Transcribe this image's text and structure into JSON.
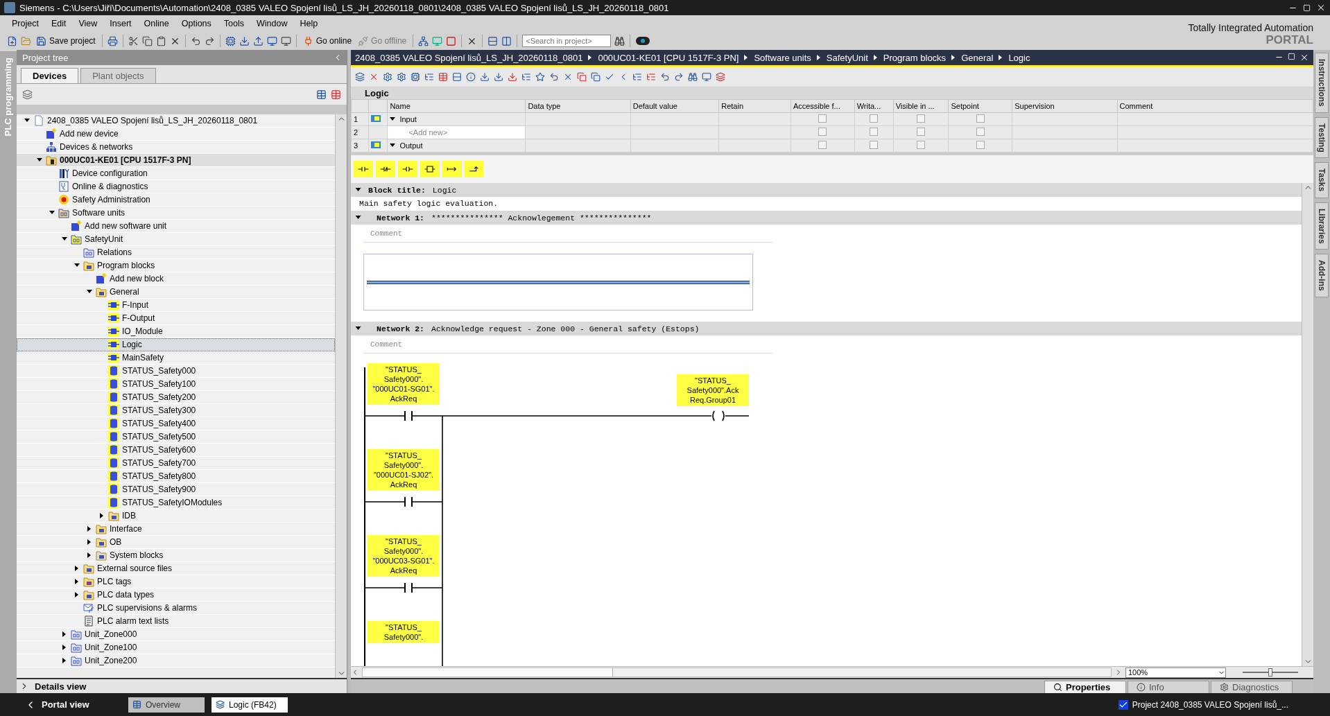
{
  "title_bar": {
    "text": "Siemens  -  C:\\Users\\Jiří\\Documents\\Automation\\2408_0385 VALEO Spojení lisů_LS_JH_20260118_0801\\2408_0385 VALEO Spojení lisů_LS_JH_20260118_0801"
  },
  "menu": [
    "Project",
    "Edit",
    "View",
    "Insert",
    "Online",
    "Options",
    "Tools",
    "Window",
    "Help"
  ],
  "toolbar": {
    "save": "Save project",
    "go_online": "Go online",
    "go_offline": "Go offline",
    "search_placeholder": "<Search in project>"
  },
  "branding": {
    "line1": "Totally Integrated Automation",
    "line2": "PORTAL"
  },
  "side_tab": "PLC programming",
  "project_tree": {
    "title": "Project tree",
    "tabs": [
      {
        "label": "Devices",
        "selected": true
      },
      {
        "label": "Plant objects",
        "selected": false
      }
    ],
    "items": [
      {
        "label": "2408_0385 VALEO Spojení lisů_LS_JH_20260118_0801",
        "kind": "project",
        "expanded": true,
        "selected": false,
        "children": [
          {
            "label": "Add new device",
            "kind": "add",
            "selected": false
          },
          {
            "label": "Devices & networks",
            "kind": "network",
            "selected": false
          },
          {
            "label": "000UC01-KE01 [CPU 1517F-3 PN]",
            "kind": "cpu",
            "expanded": true,
            "current": true,
            "selected": false,
            "children": [
              {
                "label": "Device configuration",
                "kind": "config",
                "selected": false
              },
              {
                "label": "Online & diagnostics",
                "kind": "diag",
                "selected": false
              },
              {
                "label": "Safety Administration",
                "kind": "safety",
                "selected": false
              },
              {
                "label": "Software units",
                "kind": "units",
                "expanded": true,
                "selected": false,
                "children": [
                  {
                    "label": "Add new software unit",
                    "kind": "add",
                    "selected": false
                  },
                  {
                    "label": "SafetyUnit",
                    "kind": "unit",
                    "expanded": true,
                    "selected": false,
                    "children": [
                      {
                        "label": "Relations",
                        "kind": "relations",
                        "selected": false
                      },
                      {
                        "label": "Program blocks",
                        "kind": "folder",
                        "expanded": true,
                        "selected": false,
                        "children": [
                          {
                            "label": "Add new block",
                            "kind": "add",
                            "selected": false
                          },
                          {
                            "label": "General",
                            "kind": "group",
                            "expanded": true,
                            "selected": false,
                            "children": [
                              {
                                "label": "F-Input",
                                "kind": "block",
                                "selected": false
                              },
                              {
                                "label": "F-Output",
                                "kind": "block",
                                "selected": false
                              },
                              {
                                "label": "IO_Module",
                                "kind": "block",
                                "selected": false
                              },
                              {
                                "label": "Logic",
                                "kind": "block",
                                "selected": true
                              },
                              {
                                "label": "MainSafety",
                                "kind": "block",
                                "selected": false
                              },
                              {
                                "label": "STATUS_Safety000",
                                "kind": "db",
                                "selected": false
                              },
                              {
                                "label": "STATUS_Safety100",
                                "kind": "db",
                                "selected": false
                              },
                              {
                                "label": "STATUS_Safety200",
                                "kind": "db",
                                "selected": false
                              },
                              {
                                "label": "STATUS_Safety300",
                                "kind": "db",
                                "selected": false
                              },
                              {
                                "label": "STATUS_Safety400",
                                "kind": "db",
                                "selected": false
                              },
                              {
                                "label": "STATUS_Safety500",
                                "kind": "db",
                                "selected": false
                              },
                              {
                                "label": "STATUS_Safety600",
                                "kind": "db",
                                "selected": false
                              },
                              {
                                "label": "STATUS_Safety700",
                                "kind": "db",
                                "selected": false
                              },
                              {
                                "label": "STATUS_Safety800",
                                "kind": "db",
                                "selected": false
                              },
                              {
                                "label": "STATUS_Safety900",
                                "kind": "db",
                                "selected": false
                              },
                              {
                                "label": "STATUS_SafetyIOModules",
                                "kind": "db",
                                "selected": false
                              },
                              {
                                "label": "IDB",
                                "kind": "group",
                                "expanded": false,
                                "selected": false
                              }
                            ]
                          },
                          {
                            "label": "Interface",
                            "kind": "group",
                            "expanded": false,
                            "selected": false
                          },
                          {
                            "label": "OB",
                            "kind": "group",
                            "expanded": false,
                            "selected": false
                          },
                          {
                            "label": "System blocks",
                            "kind": "system",
                            "expanded": false,
                            "selected": false
                          }
                        ]
                      },
                      {
                        "label": "External source files",
                        "kind": "folder",
                        "expanded": false,
                        "selected": false
                      },
                      {
                        "label": "PLC tags",
                        "kind": "tags",
                        "expanded": false,
                        "selected": false
                      },
                      {
                        "label": "PLC data types",
                        "kind": "types",
                        "expanded": false,
                        "selected": false
                      },
                      {
                        "label": "PLC supervisions & alarms",
                        "kind": "alarm",
                        "selected": false
                      },
                      {
                        "label": "PLC alarm text lists",
                        "kind": "list",
                        "selected": false
                      }
                    ]
                  },
                  {
                    "label": "Unit_Zone000",
                    "kind": "unit2",
                    "expanded": false,
                    "selected": false
                  },
                  {
                    "label": "Unit_Zone100",
                    "kind": "unit2",
                    "expanded": false,
                    "selected": false
                  },
                  {
                    "label": "Unit_Zone200",
                    "kind": "unit2",
                    "expanded": false,
                    "selected": false
                  }
                ]
              }
            ]
          }
        ]
      }
    ]
  },
  "editor": {
    "breadcrumb": [
      "2408_0385 VALEO Spojení lisů_LS_JH_20260118_0801",
      "000UC01-KE01 [CPU 1517F-3 PN]",
      "Software units",
      "SafetyUnit",
      "Program blocks",
      "General",
      "Logic"
    ],
    "block_name": "Logic",
    "interface": {
      "columns": [
        "Name",
        "Data type",
        "Default value",
        "Retain",
        "Accessible f...",
        "Writa...",
        "Visible in ...",
        "Setpoint",
        "Supervision",
        "Comment"
      ],
      "rows": [
        {
          "number": "1",
          "name": "Input",
          "kind": "section",
          "expanded": true,
          "flags": [
            false,
            false,
            false,
            false
          ]
        },
        {
          "number": "2",
          "name": "<Add new>",
          "kind": "add",
          "flags": [
            false,
            false,
            false,
            false
          ]
        },
        {
          "number": "3",
          "name": "Output",
          "kind": "section",
          "expanded": true,
          "flags": [
            false,
            false,
            false,
            false
          ]
        }
      ]
    },
    "block_title": {
      "label": "Block title:",
      "value": "Logic",
      "comment": "Main safety logic evaluation."
    },
    "networks": [
      {
        "label": "Network 1:",
        "title": "*************** Acknowlegement ***************",
        "comment": "Comment",
        "kind": "empty"
      },
      {
        "label": "Network 2:",
        "title": "Acknowledge request - Zone 000 - General safety (Estops)",
        "comment": "Comment",
        "kind": "ladder",
        "contacts": [
          "\"STATUS_\nSafety000\".\n\"000UC01-SG01\".\nAckReq",
          "\"STATUS_\nSafety000\".\n\"000UC01-SJ02\".\nAckReq",
          "\"STATUS_\nSafety000\".\n\"000UC03-SG01\".\nAckReq",
          "\"STATUS_\nSafety000\"."
        ],
        "coil": "\"STATUS_\nSafety000\".Ack\nReq.Group01"
      }
    ],
    "zoom": "100%",
    "zoom_slider": {
      "level": 0.5
    }
  },
  "right_tabs": [
    "Instructions",
    "Testing",
    "Tasks",
    "Libraries",
    "Add-ins"
  ],
  "details_view": "Details view",
  "inspector_tabs": [
    {
      "label": "Properties",
      "selected": true
    },
    {
      "label": "Info",
      "selected": false
    },
    {
      "label": "Diagnostics",
      "selected": false
    }
  ],
  "status_bar": {
    "portal_view": "Portal view",
    "tasks": [
      {
        "label": "Overview",
        "selected": false
      },
      {
        "label": "Logic (FB42)",
        "selected": true
      }
    ],
    "message": "Project 2408_0385 VALEO Spojení lisů_..."
  }
}
